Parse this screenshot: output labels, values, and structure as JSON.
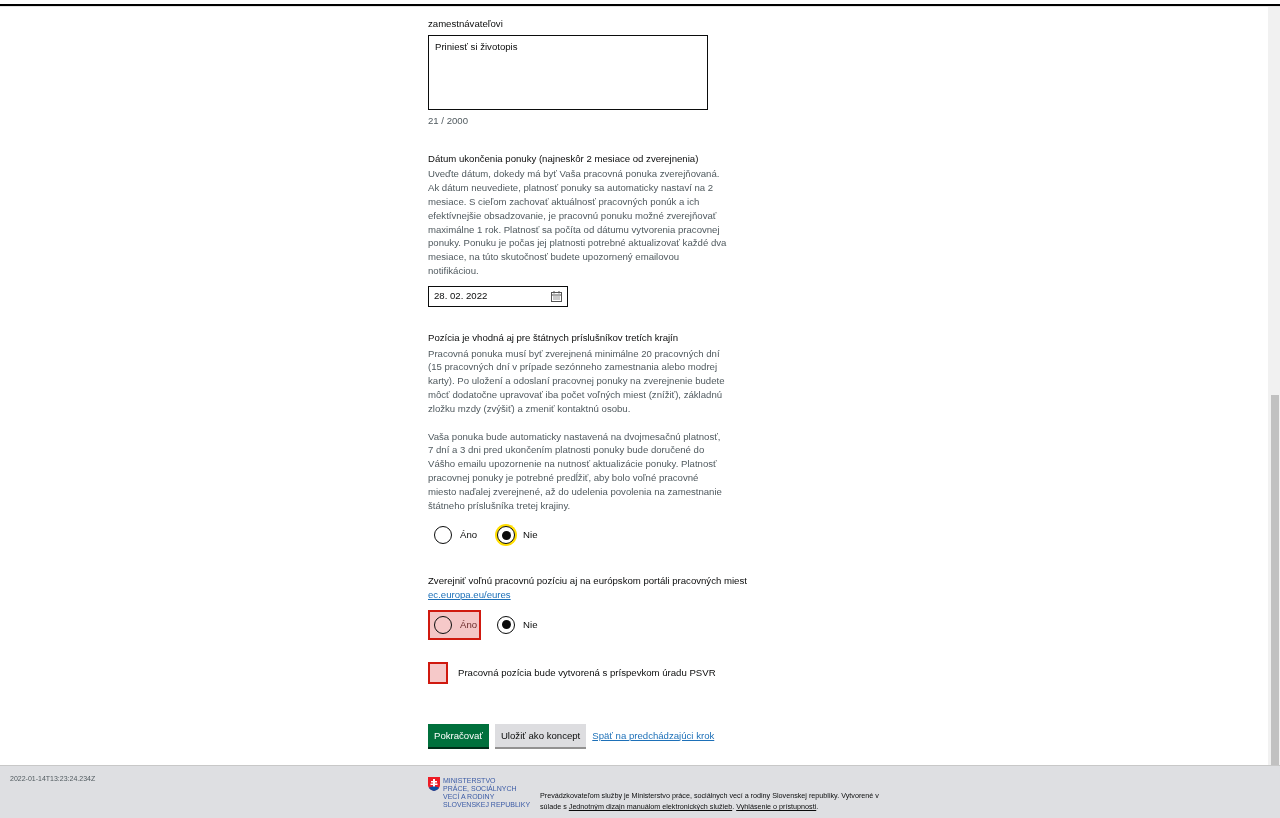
{
  "intro_label": "zamestnávateľovi",
  "note_field": {
    "value": "Priniesť si životopis",
    "counter": "21 / 2000"
  },
  "end_date": {
    "label": "Dátum ukončenia ponuky (najneskôr 2 mesiace od zverejnenia)",
    "description": "Uveďte dátum, dokedy má byť Vaša pracovná ponuka zverejňovaná. Ak dátum neuvediete, platnosť ponuky sa automaticky nastaví na 2 mesiace. S cieľom zachovať aktuálnosť pracovných ponúk a ich efektívnejšie obsadzovanie, je pracovnú ponuku možné zverejňovať maximálne 1 rok. Platnosť sa počíta od dátumu vytvorenia pracovnej ponuky. Ponuku je počas jej platnosti potrebné aktualizovať každé dva mesiace, na túto skutočnosť budete upozornený emailovou notifikáciou.",
    "value": "28. 02. 2022"
  },
  "third_country": {
    "label": "Pozícia je vhodná aj pre štátnych príslušníkov tretích krajín",
    "paragraphs": [
      "Pracovná ponuka musí byť zverejnená minimálne 20 pracovných dní (15 pracovných dní v prípade sezónneho zamestnania alebo modrej karty). Po uložení a odoslaní pracovnej ponuky na zverejnenie budete môcť dodatočne upravovať iba počet voľných miest (znížiť), základnú zložku mzdy (zvýšiť) a zmeniť kontaktnú osobu.",
      "Vaša ponuka bude automaticky nastavená na dvojmesačnú platnosť, 7 dní a 3 dni pred ukončením platnosti ponuky bude doručené do Vášho emailu upozornenie na nutnosť aktualizácie ponuky. Platnosť pracovnej ponuky je potrebné predĺžiť, aby bolo voľné pracovné miesto naďalej zverejnené, až do udelenia povolenia na zamestnanie štátneho príslušníka tretej krajiny."
    ],
    "options": [
      {
        "label": "Áno",
        "selected": false,
        "focused": false,
        "invalid": false
      },
      {
        "label": "Nie",
        "selected": true,
        "focused": true,
        "invalid": false
      }
    ]
  },
  "eures": {
    "label": "Zverejniť voľnú pracovnú pozíciu aj na európskom portáli pracovných miest",
    "link": "ec.europa.eu/eures",
    "options": [
      {
        "label": "Áno",
        "selected": false,
        "focused": false,
        "invalid": true
      },
      {
        "label": "Nie",
        "selected": true,
        "focused": false,
        "invalid": false
      }
    ]
  },
  "psvr_checkbox": {
    "label": "Pracovná pozícia bude vytvorená s príspevkom úradu PSVR",
    "checked": false,
    "invalid": true
  },
  "actions": {
    "primary": "Pokračovať",
    "secondary": "Uložiť ako koncept",
    "back_link": "Späť na predchádzajúci krok"
  },
  "footer": {
    "timestamp": "2022-01-14T13:23:24.234Z",
    "logo_lines": [
      "MINISTERSTVO",
      "PRÁCE, SOCIÁLNYCH",
      "VECÍ A RODINY",
      "SLOVENSKEJ REPUBLIKY"
    ],
    "text": "Prevádzkovateľom služby je Ministerstvo práce, sociálnych vecí a rodiny Slovenskej republiky. Vytvorené v súlade s ",
    "link_1": "Jednotným dizajn manuálom elektronických služieb",
    "separator": ". ",
    "link_2": "Vyhlásenie o prístupnosti",
    "end": "."
  }
}
